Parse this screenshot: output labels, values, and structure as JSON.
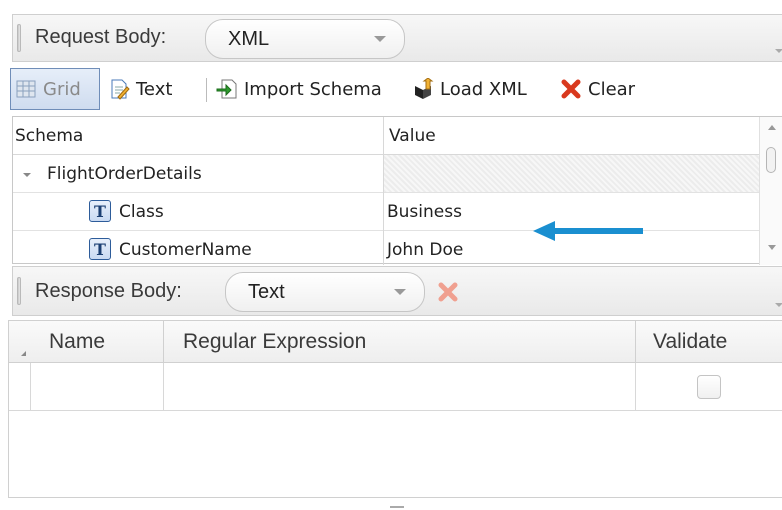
{
  "request": {
    "label": "Request Body:",
    "format": "XML"
  },
  "toolbar": {
    "grid": "Grid",
    "text": "Text",
    "import_schema": "Import Schema",
    "load_xml": "Load XML",
    "clear": "Clear"
  },
  "schema_table": {
    "headers": {
      "schema": "Schema",
      "value": "Value"
    },
    "rows": [
      {
        "name": "FlightOrderDetails",
        "value": ""
      },
      {
        "name": "Class",
        "value": "Business"
      },
      {
        "name": "CustomerName",
        "value": "John Doe"
      }
    ]
  },
  "response": {
    "label": "Response Body:",
    "format": "Text"
  },
  "validation_grid": {
    "headers": {
      "name": "Name",
      "regex": "Regular Expression",
      "validate": "Validate"
    },
    "rows": [
      {
        "name": "",
        "regex": "",
        "validate": false
      }
    ]
  },
  "colors": {
    "accent_arrow": "#1a8fd0",
    "clear_red": "#d9391e",
    "grid_selected": "#cfdcef"
  }
}
